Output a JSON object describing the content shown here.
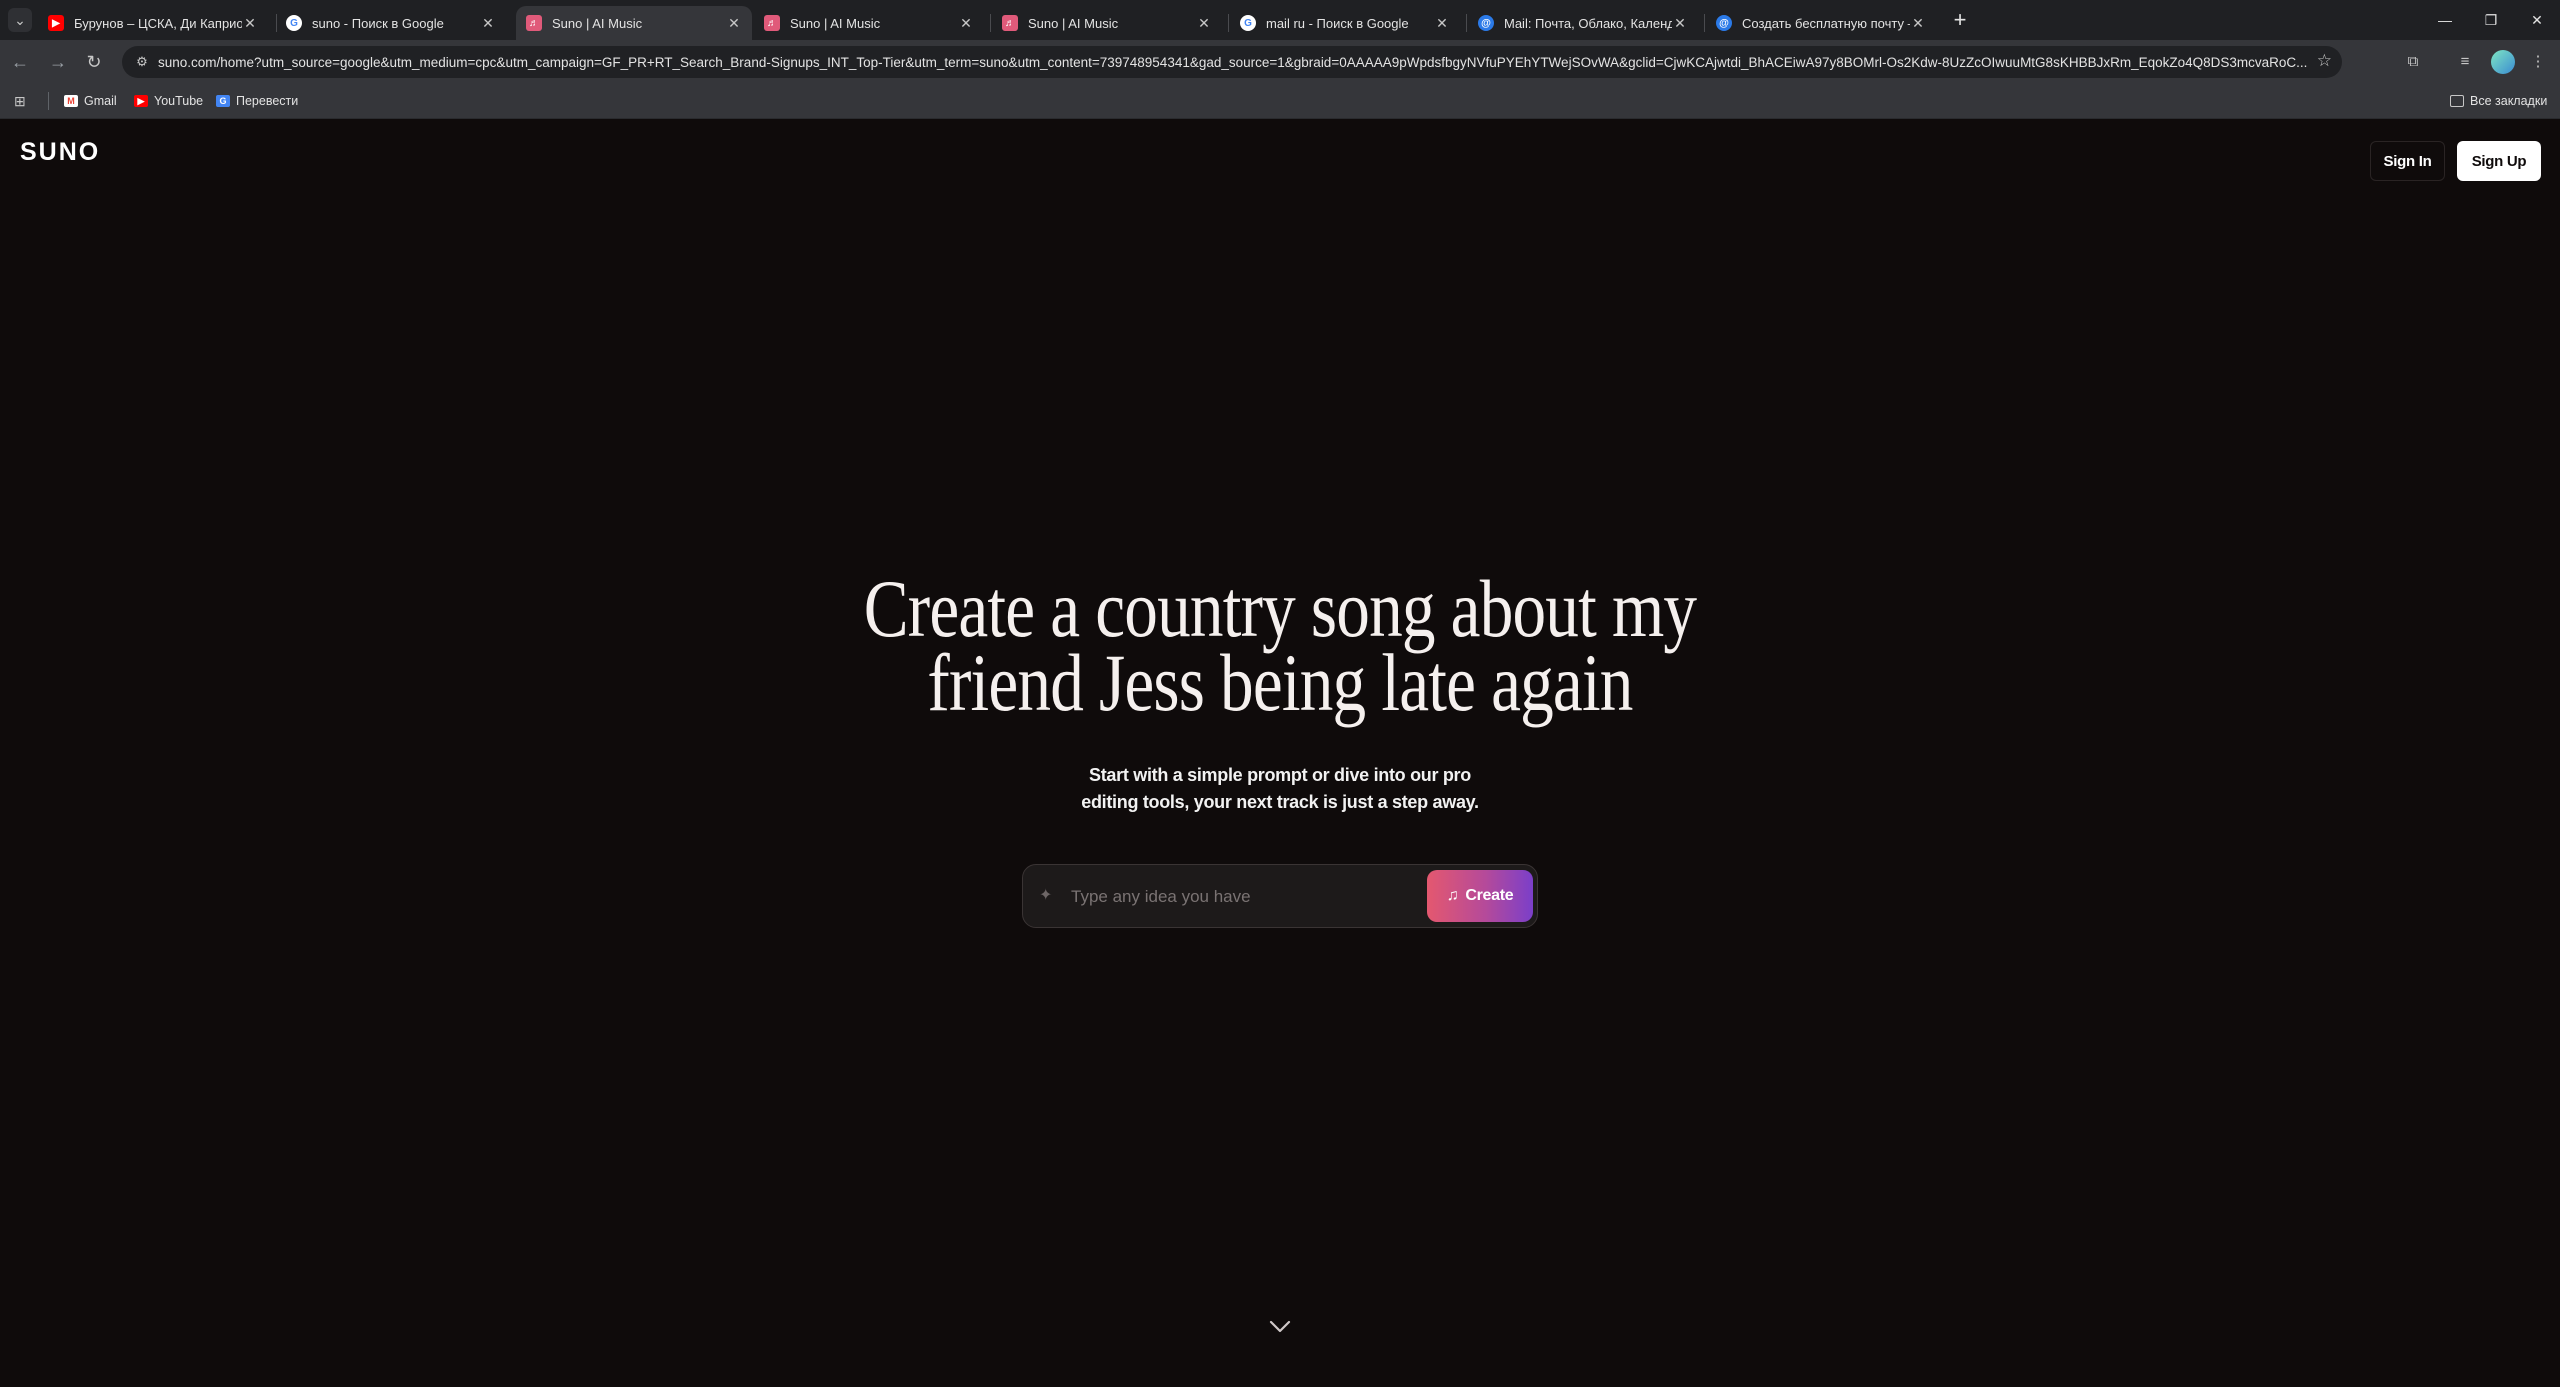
{
  "browser": {
    "tabs": [
      {
        "title": "Бурунов – ЦСКА, Ди Каприо, г",
        "favicon": "youtube-icon",
        "color": "#ff0000",
        "active": false
      },
      {
        "title": "suno - Поиск в Google",
        "favicon": "google-icon",
        "color": "#ffffff",
        "active": false
      },
      {
        "title": "Suno | AI Music",
        "favicon": "suno-icon",
        "color": "#e05a7a",
        "active": true
      },
      {
        "title": "Suno | AI Music",
        "favicon": "suno-icon",
        "color": "#e05a7a",
        "active": false
      },
      {
        "title": "Suno | AI Music",
        "favicon": "suno-icon",
        "color": "#e05a7a",
        "active": false
      },
      {
        "title": "mail ru - Поиск в Google",
        "favicon": "google-icon",
        "color": "#ffffff",
        "active": false
      },
      {
        "title": "Mail: Почта, Облако, Календар",
        "favicon": "mail-icon",
        "color": "#2b7ae8",
        "active": false
      },
      {
        "title": "Создать бесплатную почту —",
        "favicon": "mail-icon",
        "color": "#2b7ae8",
        "active": false
      }
    ],
    "url": "suno.com/home?utm_source=google&utm_medium=cpc&utm_campaign=GF_PR+RT_Search_Brand-Signups_INT_Top-Tier&utm_term=suno&utm_content=739748954341&gad_source=1&gbraid=0AAAAA9pWpdsfbgyNVfuPYEhYTWejSOvWA&gclid=CjwKCAjwtdi_BhACEiwA97y8BOMrl-Os2Kdw-8UzZcOIwuuMtG8sKHBBJxRm_EqokZo4Q8DS3mcvaRoC...",
    "bookmarks": [
      {
        "label": "Gmail",
        "icon": "gmail-icon"
      },
      {
        "label": "YouTube",
        "icon": "youtube-icon"
      },
      {
        "label": "Перевести",
        "icon": "translate-icon"
      }
    ],
    "all_bookmarks_label": "Все закладки"
  },
  "page": {
    "logo": "SUNO",
    "sign_in": "Sign In",
    "sign_up": "Sign Up",
    "hero_title_line1": "Create a country song about my",
    "hero_title_line2": "friend Jess being late again",
    "hero_sub_line1": "Start with a simple prompt or dive into our pro",
    "hero_sub_line2": "editing tools, your next track is just a step away.",
    "prompt_placeholder": "Type any idea you have",
    "create_label": "Create"
  }
}
